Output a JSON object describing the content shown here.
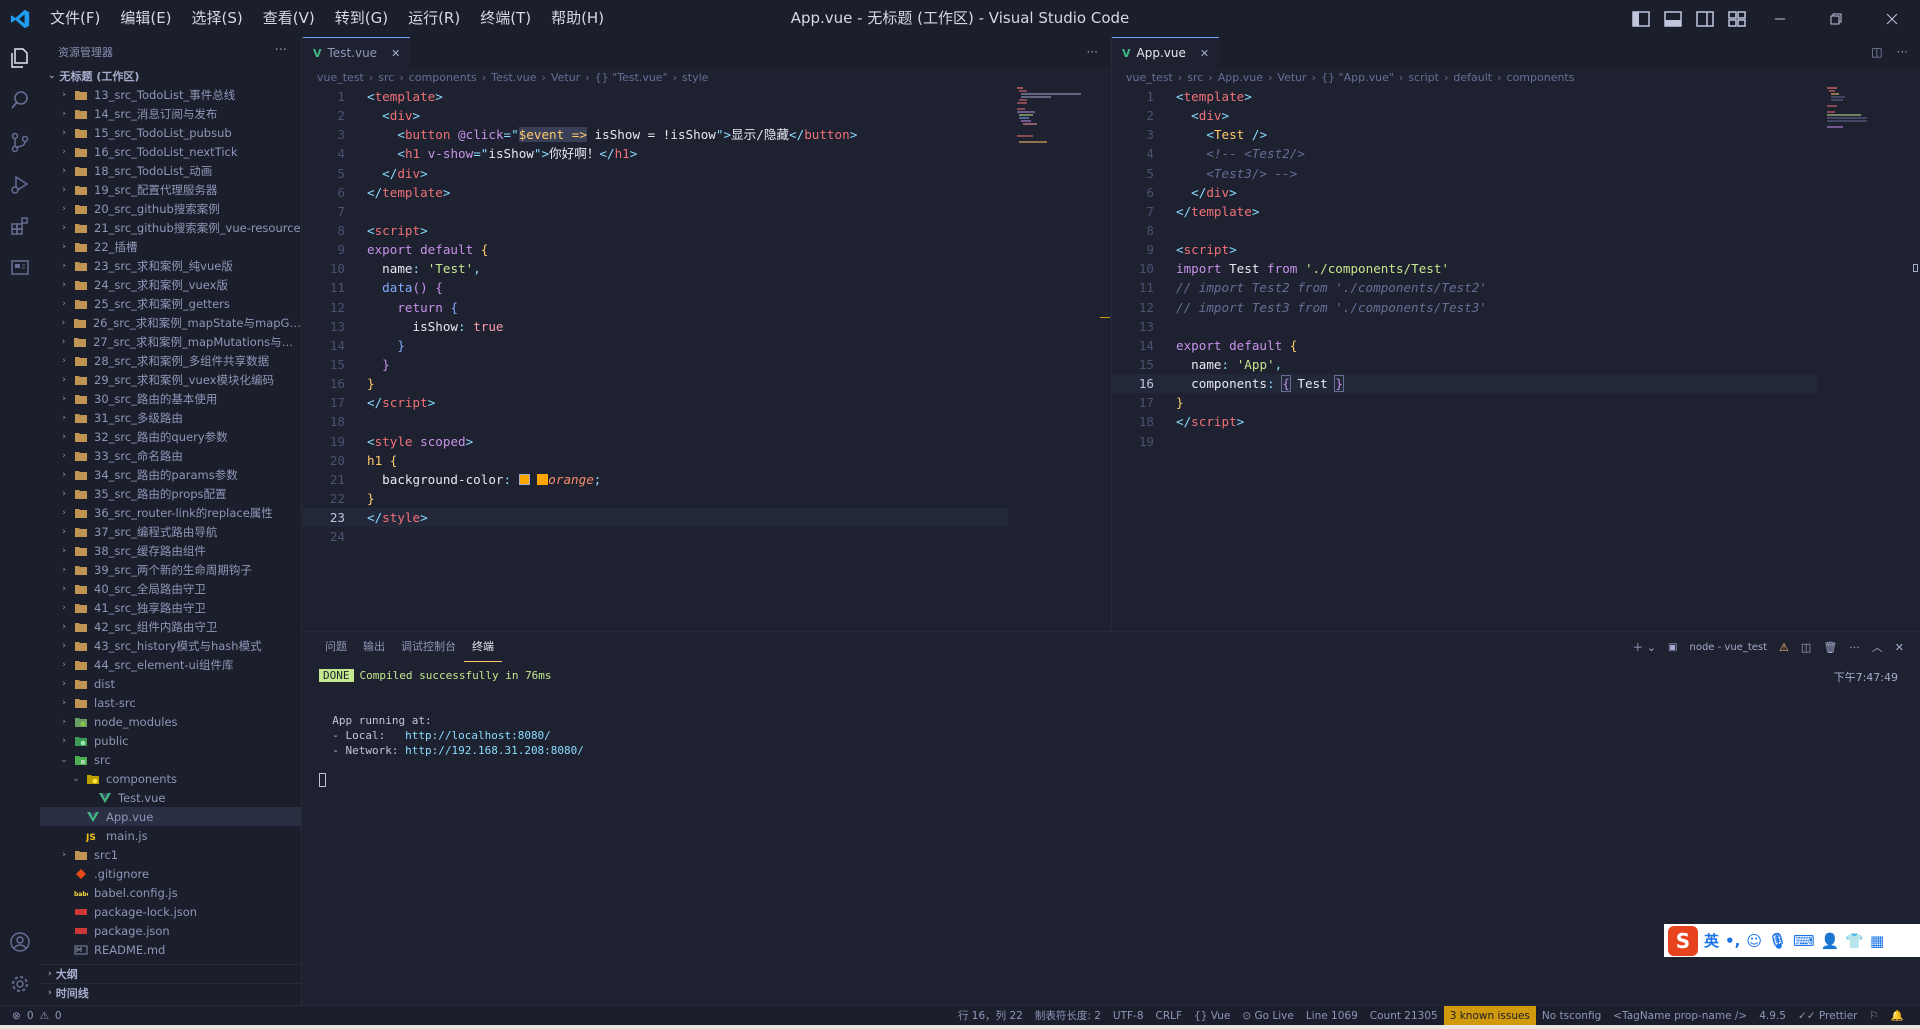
{
  "window": {
    "title": "App.vue - 无标题 (工作区) - Visual Studio Code",
    "menu": [
      "文件(F)",
      "编辑(E)",
      "选择(S)",
      "查看(V)",
      "转到(G)",
      "运行(R)",
      "终端(T)",
      "帮助(H)"
    ]
  },
  "sidebar": {
    "header": "资源管理器",
    "workspace": "无标题 (工作区)",
    "items": [
      {
        "label": "13_src_TodoList_事件总线",
        "type": "folder"
      },
      {
        "label": "14_src_消息订阅与发布",
        "type": "folder"
      },
      {
        "label": "15_src_TodoList_pubsub",
        "type": "folder"
      },
      {
        "label": "16_src_TodoList_nextTick",
        "type": "folder"
      },
      {
        "label": "18_src_TodoList_动画",
        "type": "folder"
      },
      {
        "label": "19_src_配置代理服务器",
        "type": "folder"
      },
      {
        "label": "20_src_github搜索案例",
        "type": "folder"
      },
      {
        "label": "21_src_github搜索案例_vue-resource",
        "type": "folder"
      },
      {
        "label": "22_插槽",
        "type": "folder"
      },
      {
        "label": "23_src_求和案例_纯vue版",
        "type": "folder"
      },
      {
        "label": "24_src_求和案例_vuex版",
        "type": "folder"
      },
      {
        "label": "25_src_求和案例_getters",
        "type": "folder"
      },
      {
        "label": "26_src_求和案例_mapState与mapGetters",
        "type": "folder"
      },
      {
        "label": "27_src_求和案例_mapMutations与map...",
        "type": "folder"
      },
      {
        "label": "28_src_求和案例_多组件共享数据",
        "type": "folder"
      },
      {
        "label": "29_src_求和案例_vuex模块化编码",
        "type": "folder"
      },
      {
        "label": "30_src_路由的基本使用",
        "type": "folder"
      },
      {
        "label": "31_src_多级路由",
        "type": "folder"
      },
      {
        "label": "32_src_路由的query参数",
        "type": "folder"
      },
      {
        "label": "33_src_命名路由",
        "type": "folder"
      },
      {
        "label": "34_src_路由的params参数",
        "type": "folder"
      },
      {
        "label": "35_src_路由的props配置",
        "type": "folder"
      },
      {
        "label": "36_src_router-link的replace属性",
        "type": "folder"
      },
      {
        "label": "37_src_编程式路由导航",
        "type": "folder"
      },
      {
        "label": "38_src_缓存路由组件",
        "type": "folder"
      },
      {
        "label": "39_src_两个新的生命周期钩子",
        "type": "folder"
      },
      {
        "label": "40_src_全局路由守卫",
        "type": "folder"
      },
      {
        "label": "41_src_独享路由守卫",
        "type": "folder"
      },
      {
        "label": "42_src_组件内路由守卫",
        "type": "folder"
      },
      {
        "label": "43_src_history模式与hash模式",
        "type": "folder"
      },
      {
        "label": "44_src_element-ui组件库",
        "type": "folder"
      },
      {
        "label": "dist",
        "type": "folder"
      },
      {
        "label": "last-src",
        "type": "folder"
      },
      {
        "label": "node_modules",
        "type": "folder-node"
      },
      {
        "label": "public",
        "type": "folder-public"
      },
      {
        "label": "src",
        "type": "folder-src-open"
      },
      {
        "label": "components",
        "type": "folder-comp-open"
      },
      {
        "label": "Test.vue",
        "type": "vue"
      },
      {
        "label": "App.vue",
        "type": "vue"
      },
      {
        "label": "main.js",
        "type": "js"
      },
      {
        "label": "src1",
        "type": "folder"
      },
      {
        "label": ".gitignore",
        "type": "git"
      },
      {
        "label": "babel.config.js",
        "type": "babel"
      },
      {
        "label": "package-lock.json",
        "type": "npm"
      },
      {
        "label": "package.json",
        "type": "npm"
      },
      {
        "label": "README.md",
        "type": "md"
      }
    ],
    "outline": "大纲",
    "timeline": "时间线"
  },
  "left_editor": {
    "tab": "Test.vue",
    "breadcrumbs": [
      "vue_test",
      "src",
      "components",
      "Test.vue",
      "Vetur",
      "{} \"Test.vue\"",
      "style"
    ]
  },
  "right_editor": {
    "tab": "App.vue",
    "breadcrumbs": [
      "vue_test",
      "src",
      "App.vue",
      "Vetur",
      "{} \"App.vue\"",
      "script",
      "default",
      "components"
    ]
  },
  "panel": {
    "tabs": [
      "问题",
      "输出",
      "调试控制台",
      "终端"
    ],
    "terminal_name": "node - vue_test",
    "done": "DONE",
    "compiled": "Compiled successfully in 76ms",
    "time": "下午7:47:49",
    "running": "App running at:",
    "local_label": "- Local:   ",
    "local_url": "http://localhost:8080/",
    "network_label": "- Network: ",
    "network_url": "http://192.168.31.208:8080/"
  },
  "ime": {
    "lang": "英",
    "punc": "•,"
  },
  "statusbar": {
    "errors": "0",
    "warnings": "0",
    "position": "行 16，列 22",
    "tab_size": "制表符长度: 2",
    "encoding": "UTF-8",
    "eol": "CRLF",
    "language": "Vue",
    "golive": "Go Live",
    "line": "Line 1069",
    "count": "Count 21305",
    "issues": "3 known issues",
    "tsconfig": "No tsconfig",
    "tagname": "<TagName prop-name />",
    "version": "4.9.5",
    "prettier": "Prettier"
  }
}
